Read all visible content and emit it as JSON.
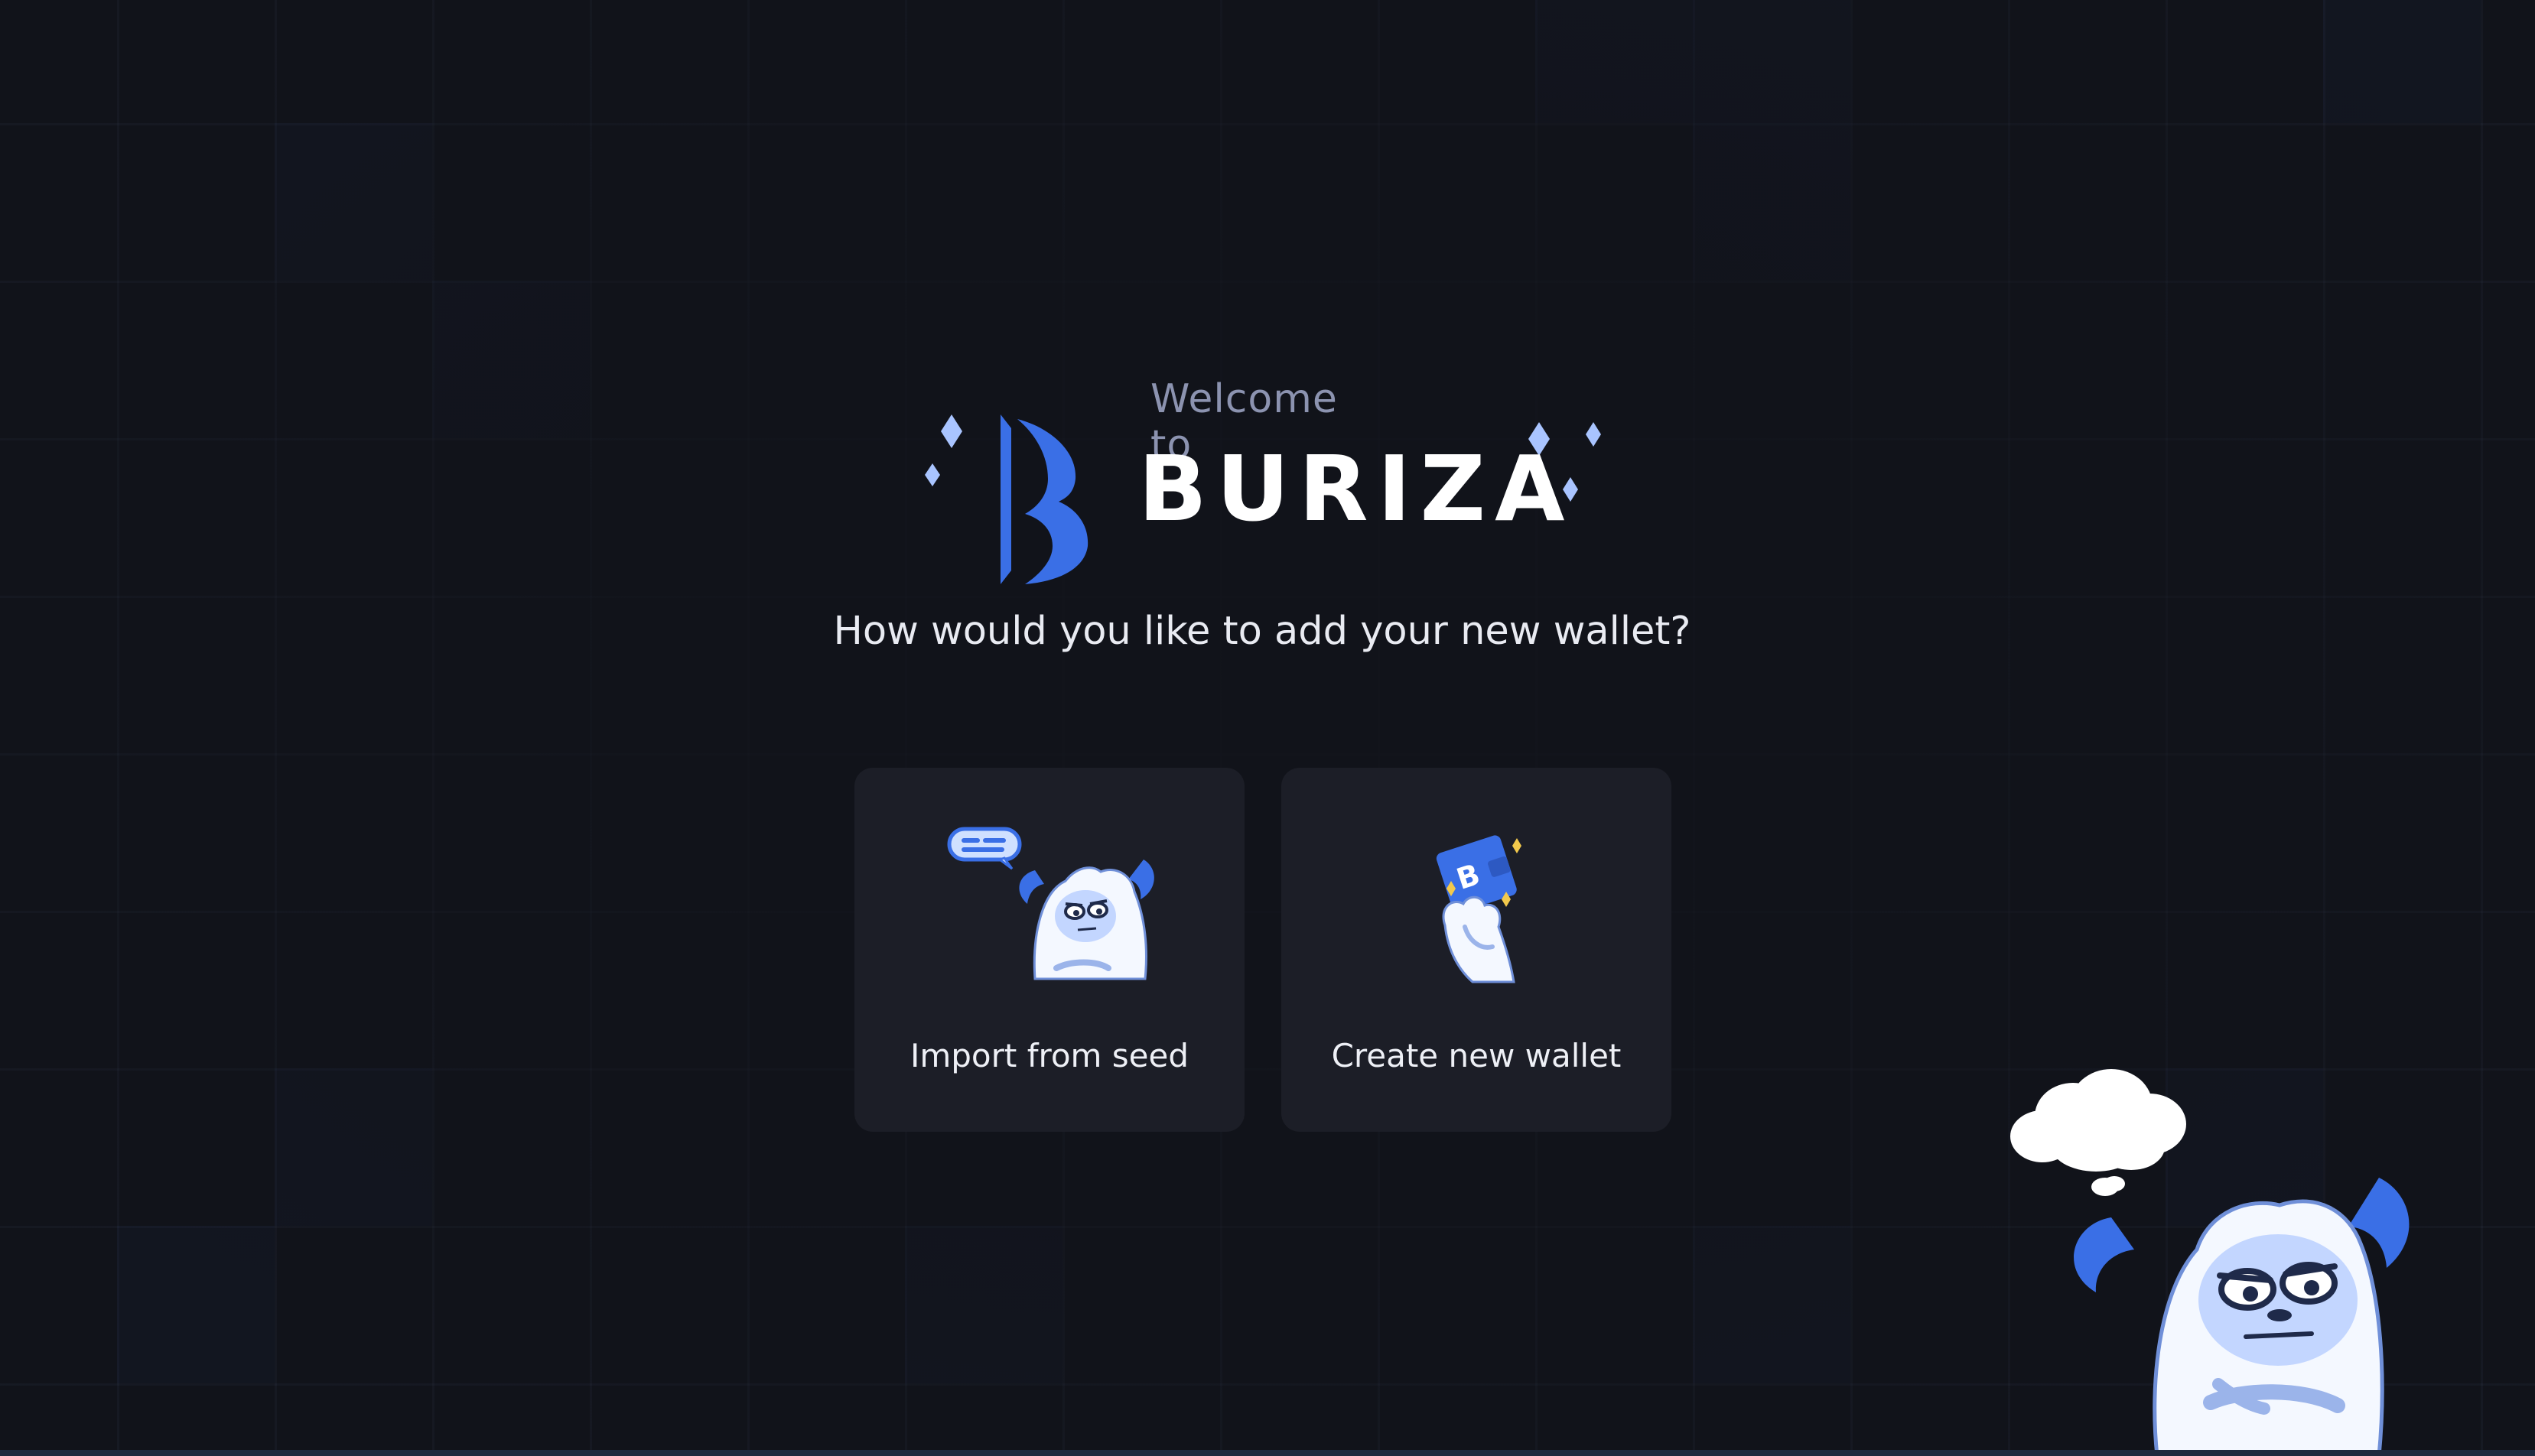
{
  "header": {
    "welcome_text": "Welcome to",
    "brand_name": "BURIZA",
    "question": "How would you like to add your new wallet?"
  },
  "options": [
    {
      "label": "Import from seed",
      "icon": "yeti-speech-bubble-icon"
    },
    {
      "label": "Create new wallet",
      "icon": "hand-holding-wallet-icon"
    }
  ],
  "colors": {
    "background": "#11131a",
    "card": "#1c1e27",
    "accent": "#3a6fe6",
    "muted_text": "#8c93b0",
    "text": "#eef0f6"
  },
  "decorations": {
    "mascot": "yeti-thinking-mascot"
  }
}
